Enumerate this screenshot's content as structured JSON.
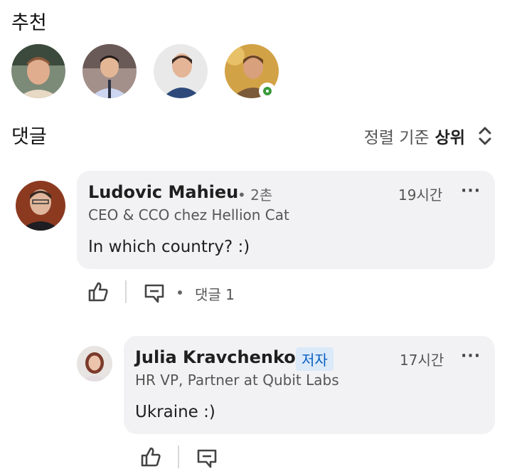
{
  "recommendations": {
    "title": "추천",
    "avatars": [
      {
        "name": "recommended-person-1"
      },
      {
        "name": "recommended-person-2"
      },
      {
        "name": "recommended-person-3"
      },
      {
        "name": "recommended-person-4",
        "online": true
      }
    ]
  },
  "comments_section": {
    "title": "댓글",
    "sort_label": "정렬 기준",
    "sort_value": "상위"
  },
  "comments": [
    {
      "author": "Ludovic Mahieu",
      "degree": "• 2촌",
      "headline": "CEO & CCO chez Hellion Cat",
      "time": "19시간",
      "body": "In which country? :)",
      "reply_count": "댓글 1",
      "more": "···"
    },
    {
      "author": "Julia Kravchenko",
      "badge": "저자",
      "headline": "HR VP, Partner at Qubit Labs",
      "time": "17시간",
      "body": "Ukraine :)",
      "more": "···"
    }
  ],
  "colors": {
    "bubble": "#f2f2f4",
    "badge_bg": "#dbe9f9",
    "badge_text": "#0a5fc2",
    "online": "#3c9a3c"
  }
}
